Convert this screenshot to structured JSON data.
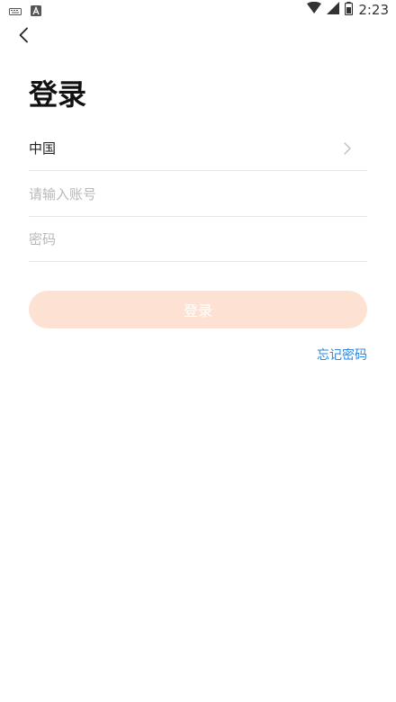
{
  "status_bar": {
    "time": "2:23",
    "icons": [
      "keyboard-icon",
      "notification-a-icon",
      "wifi-icon",
      "signal-icon",
      "battery-icon"
    ]
  },
  "header": {
    "back_icon": "chevron-left-icon"
  },
  "page": {
    "title": "登录"
  },
  "form": {
    "country_label": "中国",
    "account_placeholder": "请输入账号",
    "account_value": "",
    "password_placeholder": "密码",
    "password_value": "",
    "login_label": "登录",
    "forgot_label": "忘记密码"
  },
  "colors": {
    "login_button_bg": "#fde2d4",
    "link_blue": "#2f86e0",
    "title_text": "#111111",
    "placeholder": "#b8b8b8"
  }
}
